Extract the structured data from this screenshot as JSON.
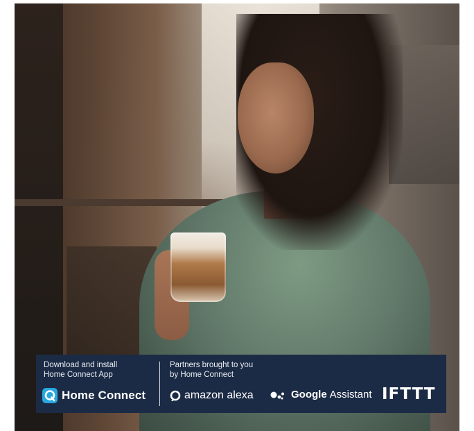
{
  "banner": {
    "left_title_line1": "Download and install",
    "left_title_line2": "Home Connect App",
    "right_title_line1": "Partners brought to you",
    "right_title_line2": "by Home Connect",
    "logos": {
      "home_connect": "Home Connect",
      "alexa": "amazon alexa",
      "google_bold": "Google",
      "google_rest": "Assistant",
      "ifttt": "IFTTT"
    },
    "colors": {
      "banner_bg": "#1c2b45",
      "home_connect_icon": "#27a8e0",
      "text": "#ffffff"
    },
    "icons": {
      "home_connect": "home-connect-icon",
      "alexa": "alexa-ring-icon",
      "google_assistant": "google-assistant-dots-icon"
    }
  }
}
